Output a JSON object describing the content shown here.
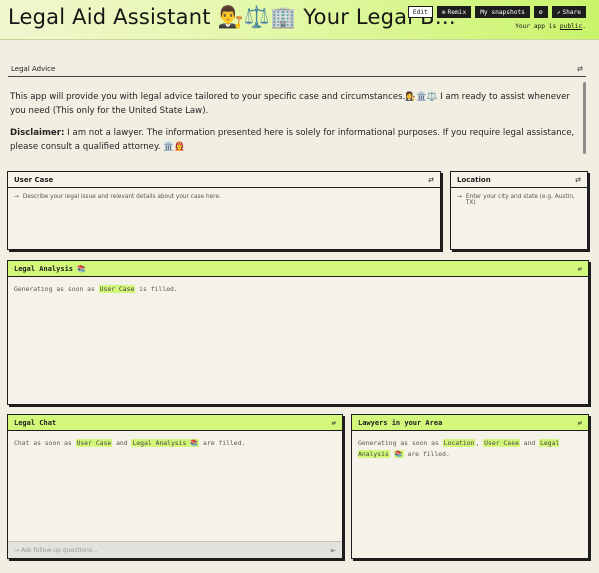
{
  "header": {
    "title": "Legal Aid Assistant 👨‍⚖️⚖️🏢 Your Legal B…",
    "buttons": {
      "edit": "Edit",
      "remix": "Remix",
      "snapshots": "My snapshots",
      "share": "Share"
    },
    "public_note_prefix": "Your app is",
    "public_link": "public",
    "public_note_suffix": "."
  },
  "legal_advice": {
    "label": "Legal Advice",
    "para1": "This app will provide you with legal advice tailored to your specific case and circumstances.👩‍⚖️🏛️⚖️ I am ready to assist whenever you need (This only for the United State Law).",
    "disclaimer_label": "Disclaimer:",
    "disclaimer_text": " I am not a lawyer. The information presented here is solely for informational purposes. If you require legal assistance, please consult a qualified attorney. 🏛️👩‍🚒"
  },
  "user_case": {
    "label": "User Case",
    "placeholder": "Describe your legal issue and relevant details about your case here."
  },
  "location": {
    "label": "Location",
    "placeholder": "Enter your city and state (e.g. Austin, TX)"
  },
  "legal_analysis": {
    "label": "Legal Analysis 📚",
    "prefix": "Generating as soon as",
    "dep": "User Case",
    "suffix": "is filled."
  },
  "legal_chat": {
    "label": "Legal Chat",
    "prefix": "Chat as soon as",
    "dep1": "User Case",
    "and": "and",
    "dep2": "Legal Analysis 📚",
    "suffix": "are filled.",
    "input_placeholder": "Ask follow-up questions..."
  },
  "lawyers": {
    "label": "Lawyers in your Area",
    "prefix": "Generating as soon as",
    "dep1": "Location",
    "comma": ",",
    "dep2": "User Case",
    "and": "and",
    "dep3": "Legal Analysis",
    "dep3_icon": "📚",
    "suffix": "are filled."
  },
  "icons": {
    "collapse": "collapse-icon",
    "arrow": "arrow-right-icon",
    "send": "send-icon"
  },
  "colors": {
    "accent": "#d2f77a",
    "background": "#f1eee2"
  }
}
